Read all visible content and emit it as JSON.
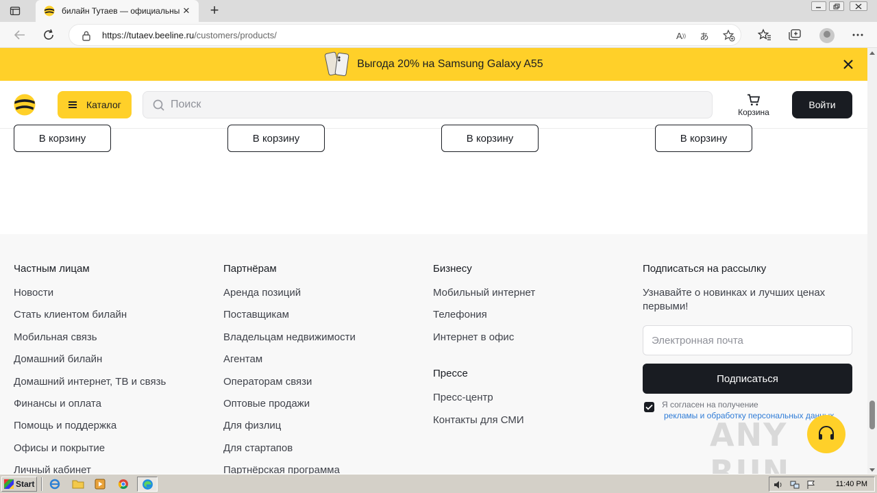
{
  "browser": {
    "tab_title": "билайн Тутаев — официальны",
    "url_host": "https://tutaev.beeline.ru",
    "url_path": "/customers/products/",
    "new_tab_symbol": "+",
    "tab_close_symbol": "✕"
  },
  "promo": {
    "text": "Выгода 20% на Samsung Galaxy A55"
  },
  "header": {
    "catalog_label": "Каталог",
    "search_placeholder": "Поиск",
    "cart_label": "Корзина",
    "login_label": "Войти"
  },
  "products": {
    "add_to_cart_labels": [
      "В корзину",
      "В корзину",
      "В корзину",
      "В корзину"
    ]
  },
  "footer": {
    "columns": [
      {
        "heading": "Частным лицам",
        "links": [
          "Новости",
          "Стать клиентом билайн",
          "Мобильная связь",
          "Домашний билайн",
          "Домашний интернет, ТВ и связь",
          "Финансы и оплата",
          "Помощь и поддержка",
          "Офисы и покрытие",
          "Личный кабинет"
        ]
      },
      {
        "heading": "Партнёрам",
        "links": [
          "Аренда позиций",
          "Поставщикам",
          "Владельцам недвижимости",
          "Агентам",
          "Операторам связи",
          "Оптовые продажи",
          "Для физлиц",
          "Для стартапов",
          "Партнёрская программа"
        ]
      },
      {
        "heading": "Бизнесу",
        "links": [
          "Мобильный интернет",
          "Телефония",
          "Интернет в офис"
        ]
      },
      {
        "heading": "Прессе",
        "links": [
          "Пресс-центр",
          "Контакты для СМИ"
        ]
      }
    ],
    "subscribe": {
      "heading": "Подписаться на рассылку",
      "description": "Узнавайте о новинках и лучших ценах первыми!",
      "email_placeholder": "Электронная почта",
      "button_label": "Подписаться",
      "consent_line1": "Я согласен на получение",
      "consent_line2": "рекламы и обработку персональных данных"
    }
  },
  "watermark": "ANY RUN",
  "taskbar": {
    "start_label": "Start",
    "clock": "11:40 PM"
  },
  "colors": {
    "brand_yellow": "#ffd029",
    "dark": "#191c22",
    "link_blue": "#2e7bd6"
  }
}
